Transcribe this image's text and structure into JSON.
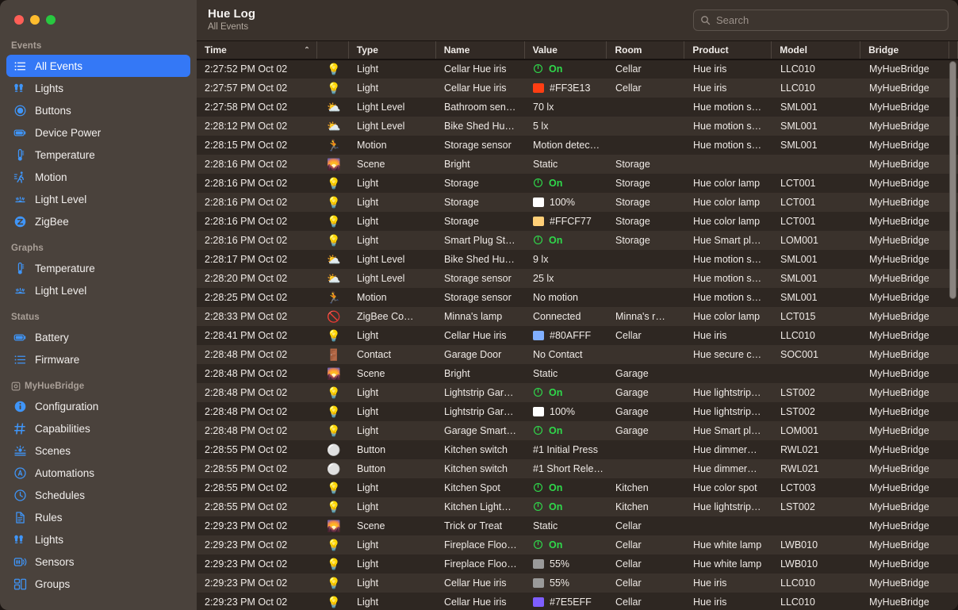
{
  "window": {
    "traffic_lights": [
      "close",
      "minimize",
      "zoom"
    ]
  },
  "header": {
    "title": "Hue Log",
    "subtitle": "All Events"
  },
  "search": {
    "placeholder": "Search",
    "value": "",
    "icon": "search-icon"
  },
  "sidebar": {
    "sections": [
      {
        "label": "Events",
        "icon": null,
        "items": [
          {
            "label": "All Events",
            "icon": "list-icon",
            "selected": true
          },
          {
            "label": "Lights",
            "icon": "bulbs-icon",
            "selected": false
          },
          {
            "label": "Buttons",
            "icon": "button-icon",
            "selected": false
          },
          {
            "label": "Device Power",
            "icon": "battery-icon",
            "selected": false
          },
          {
            "label": "Temperature",
            "icon": "thermometer-icon",
            "selected": false
          },
          {
            "label": "Motion",
            "icon": "motion-icon",
            "selected": false
          },
          {
            "label": "Light Level",
            "icon": "lightlevel-icon",
            "selected": false
          },
          {
            "label": "ZigBee",
            "icon": "zigbee-icon",
            "selected": false
          }
        ]
      },
      {
        "label": "Graphs",
        "icon": null,
        "items": [
          {
            "label": "Temperature",
            "icon": "thermometer-icon",
            "selected": false
          },
          {
            "label": "Light Level",
            "icon": "lightlevel-icon",
            "selected": false
          }
        ]
      },
      {
        "label": "Status",
        "icon": null,
        "items": [
          {
            "label": "Battery",
            "icon": "battery-icon",
            "selected": false
          },
          {
            "label": "Firmware",
            "icon": "list-icon",
            "selected": false
          }
        ]
      },
      {
        "label": "MyHueBridge",
        "icon": "bridge-icon",
        "items": [
          {
            "label": "Configuration",
            "icon": "info-icon",
            "selected": false
          },
          {
            "label": "Capabilities",
            "icon": "hash-icon",
            "selected": false
          },
          {
            "label": "Scenes",
            "icon": "scenes-icon",
            "selected": false
          },
          {
            "label": "Automations",
            "icon": "automations-icon",
            "selected": false
          },
          {
            "label": "Schedules",
            "icon": "clock-icon",
            "selected": false
          },
          {
            "label": "Rules",
            "icon": "document-icon",
            "selected": false
          },
          {
            "label": "Lights",
            "icon": "bulbs-icon",
            "selected": false
          },
          {
            "label": "Sensors",
            "icon": "sensors-icon",
            "selected": false
          },
          {
            "label": "Groups",
            "icon": "groups-icon",
            "selected": false
          }
        ]
      }
    ]
  },
  "table": {
    "columns": [
      {
        "key": "time",
        "label": "Time",
        "sorted": "asc"
      },
      {
        "key": "icon",
        "label": ""
      },
      {
        "key": "type",
        "label": "Type"
      },
      {
        "key": "name",
        "label": "Name"
      },
      {
        "key": "value",
        "label": "Value"
      },
      {
        "key": "room",
        "label": "Room"
      },
      {
        "key": "product",
        "label": "Product"
      },
      {
        "key": "model",
        "label": "Model"
      },
      {
        "key": "bridge",
        "label": "Bridge"
      }
    ],
    "sort_arrow": "⌃",
    "rows": [
      {
        "time": "2:27:52 PM Oct 02",
        "icon": "💡",
        "type": "Light",
        "name": "Cellar Hue iris",
        "value": "On",
        "value_kind": "power",
        "room": "Cellar",
        "product": "Hue iris",
        "model": "LLC010",
        "bridge": "MyHueBridge"
      },
      {
        "time": "2:27:57 PM Oct 02",
        "icon": "💡",
        "type": "Light",
        "name": "Cellar Hue iris",
        "value": "#FF3E13",
        "value_kind": "color",
        "swatch": "#FF3E13",
        "room": "Cellar",
        "product": "Hue iris",
        "model": "LLC010",
        "bridge": "MyHueBridge"
      },
      {
        "time": "2:27:58 PM Oct 02",
        "icon": "⛅",
        "type": "Light Level",
        "name": "Bathroom sen…",
        "value": "70 lx",
        "value_kind": "text",
        "room": "",
        "product": "Hue motion s…",
        "model": "SML001",
        "bridge": "MyHueBridge"
      },
      {
        "time": "2:28:12 PM Oct 02",
        "icon": "⛅",
        "type": "Light Level",
        "name": "Bike Shed Hu…",
        "value": "5 lx",
        "value_kind": "text",
        "room": "",
        "product": "Hue motion s…",
        "model": "SML001",
        "bridge": "MyHueBridge"
      },
      {
        "time": "2:28:15 PM Oct 02",
        "icon": "🏃",
        "type": "Motion",
        "name": "Storage sensor",
        "value": "Motion detec…",
        "value_kind": "text",
        "room": "",
        "product": "Hue motion s…",
        "model": "SML001",
        "bridge": "MyHueBridge"
      },
      {
        "time": "2:28:16 PM Oct 02",
        "icon": "🌄",
        "type": "Scene",
        "name": "Bright",
        "value": "Static",
        "value_kind": "text",
        "room": "Storage",
        "product": "",
        "model": "",
        "bridge": "MyHueBridge"
      },
      {
        "time": "2:28:16 PM Oct 02",
        "icon": "💡",
        "type": "Light",
        "name": "Storage",
        "value": "On",
        "value_kind": "power",
        "room": "Storage",
        "product": "Hue color lamp",
        "model": "LCT001",
        "bridge": "MyHueBridge"
      },
      {
        "time": "2:28:16 PM Oct 02",
        "icon": "💡",
        "type": "Light",
        "name": "Storage",
        "value": "100%",
        "value_kind": "color",
        "swatch": "#FFFFFF",
        "room": "Storage",
        "product": "Hue color lamp",
        "model": "LCT001",
        "bridge": "MyHueBridge"
      },
      {
        "time": "2:28:16 PM Oct 02",
        "icon": "💡",
        "type": "Light",
        "name": "Storage",
        "value": "#FFCF77",
        "value_kind": "color",
        "swatch": "#FFCF77",
        "room": "Storage",
        "product": "Hue color lamp",
        "model": "LCT001",
        "bridge": "MyHueBridge"
      },
      {
        "time": "2:28:16 PM Oct 02",
        "icon": "💡",
        "type": "Light",
        "name": "Smart Plug St…",
        "value": "On",
        "value_kind": "power",
        "room": "Storage",
        "product": "Hue Smart pl…",
        "model": "LOM001",
        "bridge": "MyHueBridge"
      },
      {
        "time": "2:28:17 PM Oct 02",
        "icon": "⛅",
        "type": "Light Level",
        "name": "Bike Shed Hu…",
        "value": "9 lx",
        "value_kind": "text",
        "room": "",
        "product": "Hue motion s…",
        "model": "SML001",
        "bridge": "MyHueBridge"
      },
      {
        "time": "2:28:20 PM Oct 02",
        "icon": "⛅",
        "type": "Light Level",
        "name": "Storage sensor",
        "value": "25 lx",
        "value_kind": "text",
        "room": "",
        "product": "Hue motion s…",
        "model": "SML001",
        "bridge": "MyHueBridge"
      },
      {
        "time": "2:28:25 PM Oct 02",
        "icon": "🏃",
        "type": "Motion",
        "name": "Storage sensor",
        "value": "No motion",
        "value_kind": "text",
        "room": "",
        "product": "Hue motion s…",
        "model": "SML001",
        "bridge": "MyHueBridge"
      },
      {
        "time": "2:28:33 PM Oct 02",
        "icon": "🚫",
        "type": "ZigBee Co…",
        "name": "Minna's lamp",
        "value": "Connected",
        "value_kind": "text",
        "room": "Minna's r…",
        "product": "Hue color lamp",
        "model": "LCT015",
        "bridge": "MyHueBridge"
      },
      {
        "time": "2:28:41 PM Oct 02",
        "icon": "💡",
        "type": "Light",
        "name": "Cellar Hue iris",
        "value": "#80AFFF",
        "value_kind": "color",
        "swatch": "#80AFFF",
        "room": "Cellar",
        "product": "Hue iris",
        "model": "LLC010",
        "bridge": "MyHueBridge"
      },
      {
        "time": "2:28:48 PM Oct 02",
        "icon": "🚪",
        "type": "Contact",
        "name": "Garage Door",
        "value": "No Contact",
        "value_kind": "text",
        "room": "",
        "product": "Hue secure c…",
        "model": "SOC001",
        "bridge": "MyHueBridge"
      },
      {
        "time": "2:28:48 PM Oct 02",
        "icon": "🌄",
        "type": "Scene",
        "name": "Bright",
        "value": "Static",
        "value_kind": "text",
        "room": "Garage",
        "product": "",
        "model": "",
        "bridge": "MyHueBridge"
      },
      {
        "time": "2:28:48 PM Oct 02",
        "icon": "💡",
        "type": "Light",
        "name": "Lightstrip Gar…",
        "value": "On",
        "value_kind": "power",
        "room": "Garage",
        "product": "Hue lightstrip…",
        "model": "LST002",
        "bridge": "MyHueBridge"
      },
      {
        "time": "2:28:48 PM Oct 02",
        "icon": "💡",
        "type": "Light",
        "name": "Lightstrip Gar…",
        "value": "100%",
        "value_kind": "color",
        "swatch": "#FFFFFF",
        "room": "Garage",
        "product": "Hue lightstrip…",
        "model": "LST002",
        "bridge": "MyHueBridge"
      },
      {
        "time": "2:28:48 PM Oct 02",
        "icon": "💡",
        "type": "Light",
        "name": "Garage Smart…",
        "value": "On",
        "value_kind": "power",
        "room": "Garage",
        "product": "Hue Smart pl…",
        "model": "LOM001",
        "bridge": "MyHueBridge"
      },
      {
        "time": "2:28:55 PM Oct 02",
        "icon": "⚪",
        "type": "Button",
        "name": "Kitchen switch",
        "value": "#1 Initial Press",
        "value_kind": "text",
        "room": "",
        "product": "Hue dimmer…",
        "model": "RWL021",
        "bridge": "MyHueBridge"
      },
      {
        "time": "2:28:55 PM Oct 02",
        "icon": "⚪",
        "type": "Button",
        "name": "Kitchen switch",
        "value": "#1 Short Rele…",
        "value_kind": "text",
        "room": "",
        "product": "Hue dimmer…",
        "model": "RWL021",
        "bridge": "MyHueBridge"
      },
      {
        "time": "2:28:55 PM Oct 02",
        "icon": "💡",
        "type": "Light",
        "name": "Kitchen Spot",
        "value": "On",
        "value_kind": "power",
        "room": "Kitchen",
        "product": "Hue color spot",
        "model": "LCT003",
        "bridge": "MyHueBridge"
      },
      {
        "time": "2:28:55 PM Oct 02",
        "icon": "💡",
        "type": "Light",
        "name": "Kitchen Light…",
        "value": "On",
        "value_kind": "power",
        "room": "Kitchen",
        "product": "Hue lightstrip…",
        "model": "LST002",
        "bridge": "MyHueBridge"
      },
      {
        "time": "2:29:23 PM Oct 02",
        "icon": "🌄",
        "type": "Scene",
        "name": "Trick or Treat",
        "value": "Static",
        "value_kind": "text",
        "room": "Cellar",
        "product": "",
        "model": "",
        "bridge": "MyHueBridge"
      },
      {
        "time": "2:29:23 PM Oct 02",
        "icon": "💡",
        "type": "Light",
        "name": "Fireplace Floo…",
        "value": "On",
        "value_kind": "power",
        "room": "Cellar",
        "product": "Hue white lamp",
        "model": "LWB010",
        "bridge": "MyHueBridge"
      },
      {
        "time": "2:29:23 PM Oct 02",
        "icon": "💡",
        "type": "Light",
        "name": "Fireplace Floo…",
        "value": "55%",
        "value_kind": "color",
        "swatch": "#9a9a9a",
        "room": "Cellar",
        "product": "Hue white lamp",
        "model": "LWB010",
        "bridge": "MyHueBridge"
      },
      {
        "time": "2:29:23 PM Oct 02",
        "icon": "💡",
        "type": "Light",
        "name": "Cellar Hue iris",
        "value": "55%",
        "value_kind": "color",
        "swatch": "#9a9a9a",
        "room": "Cellar",
        "product": "Hue iris",
        "model": "LLC010",
        "bridge": "MyHueBridge"
      },
      {
        "time": "2:29:23 PM Oct 02",
        "icon": "💡",
        "type": "Light",
        "name": "Cellar Hue iris",
        "value": "#7E5EFF",
        "value_kind": "color",
        "swatch": "#7E5EFF",
        "room": "Cellar",
        "product": "Hue iris",
        "model": "LLC010",
        "bridge": "MyHueBridge"
      }
    ]
  }
}
